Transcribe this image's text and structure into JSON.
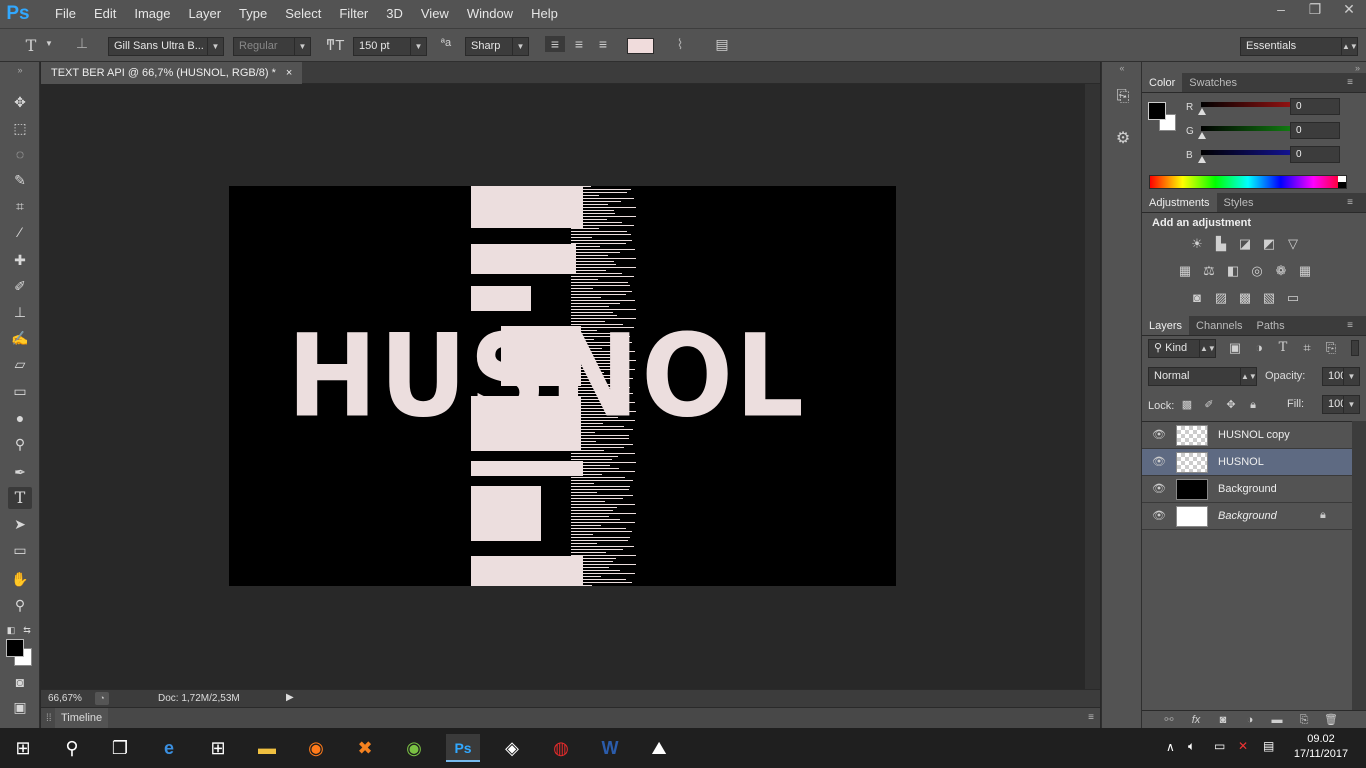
{
  "app": {
    "logo": "Ps"
  },
  "menu": [
    "File",
    "Edit",
    "Image",
    "Layer",
    "Type",
    "Select",
    "Filter",
    "3D",
    "View",
    "Window",
    "Help"
  ],
  "window_controls": [
    "–",
    "❐",
    "✕"
  ],
  "options": {
    "tool_icon": "T",
    "font_family": "Gill Sans Ultra B...",
    "font_style": "Regular",
    "font_size": "150 pt",
    "aa_label": "ªa",
    "antialias": "Sharp",
    "text_color": "#f0dcdc",
    "workspace": "Essentials"
  },
  "document": {
    "tab_title": "TEXT BER API @ 66,7% (HUSNOL, RGB/8) *",
    "tab_close": "×",
    "canvas_text": "HUSNOL",
    "text_color": "#ecdede"
  },
  "status": {
    "zoom": "66,67%",
    "doc": "Doc: 1,72M/2,53M"
  },
  "timeline": {
    "label": "Timeline"
  },
  "color_panel": {
    "tabs": [
      "Color",
      "Swatches"
    ],
    "channels": [
      {
        "label": "R",
        "value": "0",
        "color": "#d21a1a"
      },
      {
        "label": "G",
        "value": "0",
        "color": "#19b219"
      },
      {
        "label": "B",
        "value": "0",
        "color": "#1a1ad2"
      }
    ]
  },
  "adjustments_panel": {
    "tabs": [
      "Adjustments",
      "Styles"
    ],
    "heading": "Add an adjustment"
  },
  "layers_panel": {
    "tabs": [
      "Layers",
      "Channels",
      "Paths"
    ],
    "filter_kind": "Kind",
    "blend_mode": "Normal",
    "opacity_label": "Opacity:",
    "opacity": "100%",
    "lock_label": "Lock:",
    "fill_label": "Fill:",
    "fill": "100%",
    "layers": [
      {
        "name": "HUSNOL copy",
        "thumb": "transparent",
        "selected": false
      },
      {
        "name": "HUSNOL",
        "thumb": "transparent",
        "selected": true
      },
      {
        "name": "Background",
        "thumb": "black",
        "selected": false
      },
      {
        "name": "Background",
        "thumb": "white",
        "selected": false,
        "locked": true
      }
    ]
  },
  "taskbar": {
    "time": "09.02",
    "date": "17/11/2017"
  }
}
